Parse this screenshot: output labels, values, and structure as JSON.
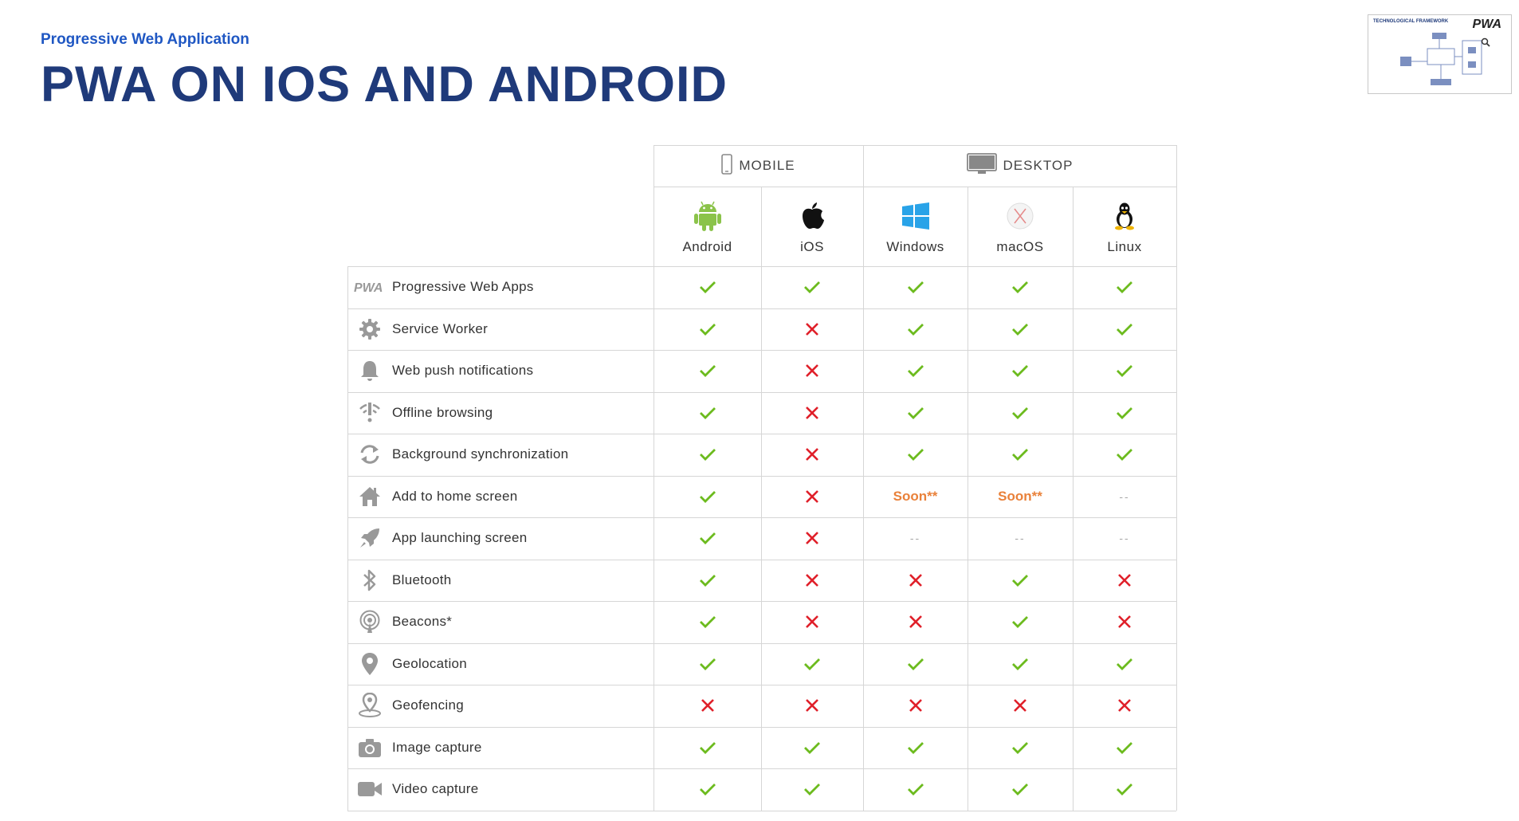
{
  "header": {
    "subtitle": "Progressive Web Application",
    "title": "PWA ON IOS AND ANDROID"
  },
  "thumbnail": {
    "title": "TECHNOLOGICAL FRAMEWORK",
    "logo": "PWA",
    "zoom_icon": "magnifier-icon"
  },
  "groups": {
    "mobile": "MOBILE",
    "desktop": "DESKTOP"
  },
  "platforms": [
    {
      "name": "Android",
      "icon": "android-icon"
    },
    {
      "name": "iOS",
      "icon": "apple-icon"
    },
    {
      "name": "Windows",
      "icon": "windows-icon"
    },
    {
      "name": "macOS",
      "icon": "macos-icon"
    },
    {
      "name": "Linux",
      "icon": "linux-icon"
    }
  ],
  "colors": {
    "check": "#6cbb1e",
    "cross": "#e0202a",
    "soon": "#e9813a"
  },
  "features": [
    {
      "label": "Progressive Web Apps",
      "icon": "pwa-icon",
      "values": [
        "check",
        "check",
        "check",
        "check",
        "check"
      ]
    },
    {
      "label": "Service Worker",
      "icon": "gear-icon",
      "values": [
        "check",
        "cross",
        "check",
        "check",
        "check"
      ]
    },
    {
      "label": "Web push notifications",
      "icon": "bell-icon",
      "values": [
        "check",
        "cross",
        "check",
        "check",
        "check"
      ]
    },
    {
      "label": "Offline browsing",
      "icon": "offline-icon",
      "values": [
        "check",
        "cross",
        "check",
        "check",
        "check"
      ]
    },
    {
      "label": "Background synchronization",
      "icon": "sync-icon",
      "values": [
        "check",
        "cross",
        "check",
        "check",
        "check"
      ]
    },
    {
      "label": "Add to home screen",
      "icon": "home-icon",
      "values": [
        "check",
        "cross",
        "Soon**",
        "Soon**",
        "--"
      ]
    },
    {
      "label": "App launching screen",
      "icon": "rocket-icon",
      "values": [
        "check",
        "cross",
        "--",
        "--",
        "--"
      ]
    },
    {
      "label": "Bluetooth",
      "icon": "bluetooth-icon",
      "values": [
        "check",
        "cross",
        "cross",
        "check",
        "cross"
      ]
    },
    {
      "label": "Beacons*",
      "icon": "beacon-icon",
      "values": [
        "check",
        "cross",
        "cross",
        "check",
        "cross"
      ]
    },
    {
      "label": "Geolocation",
      "icon": "location-pin-icon",
      "values": [
        "check",
        "check",
        "check",
        "check",
        "check"
      ]
    },
    {
      "label": "Geofencing",
      "icon": "geofence-icon",
      "values": [
        "cross",
        "cross",
        "cross",
        "cross",
        "cross"
      ]
    },
    {
      "label": "Image capture",
      "icon": "camera-icon",
      "values": [
        "check",
        "check",
        "check",
        "check",
        "check"
      ]
    },
    {
      "label": "Video capture",
      "icon": "video-camera-icon",
      "values": [
        "check",
        "check",
        "check",
        "check",
        "check"
      ]
    }
  ]
}
